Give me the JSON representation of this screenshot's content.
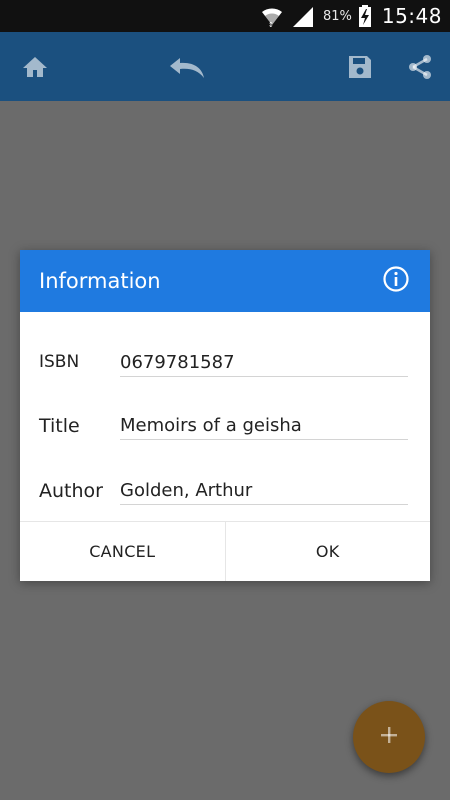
{
  "status_bar": {
    "battery_percent": "81%",
    "time": "15:48",
    "icons": [
      "wifi-icon",
      "signal-icon",
      "battery-charging-icon"
    ]
  },
  "app_bar": {
    "icons": [
      "home-icon",
      "undo-icon",
      "save-icon",
      "share-icon"
    ],
    "color": "#1b507f"
  },
  "dialog": {
    "title": "Information",
    "header_color": "#1f7ae0",
    "info_icon": "info-icon",
    "fields": [
      {
        "label": "ISBN",
        "value": "0679781587"
      },
      {
        "label": "Title",
        "value": "Memoirs of a geisha"
      },
      {
        "label": "Author",
        "value": "Golden, Arthur"
      }
    ],
    "actions": {
      "cancel_label": "CANCEL",
      "ok_label": "OK"
    }
  },
  "fab": {
    "icon": "plus-icon",
    "color": "#7a5219"
  }
}
